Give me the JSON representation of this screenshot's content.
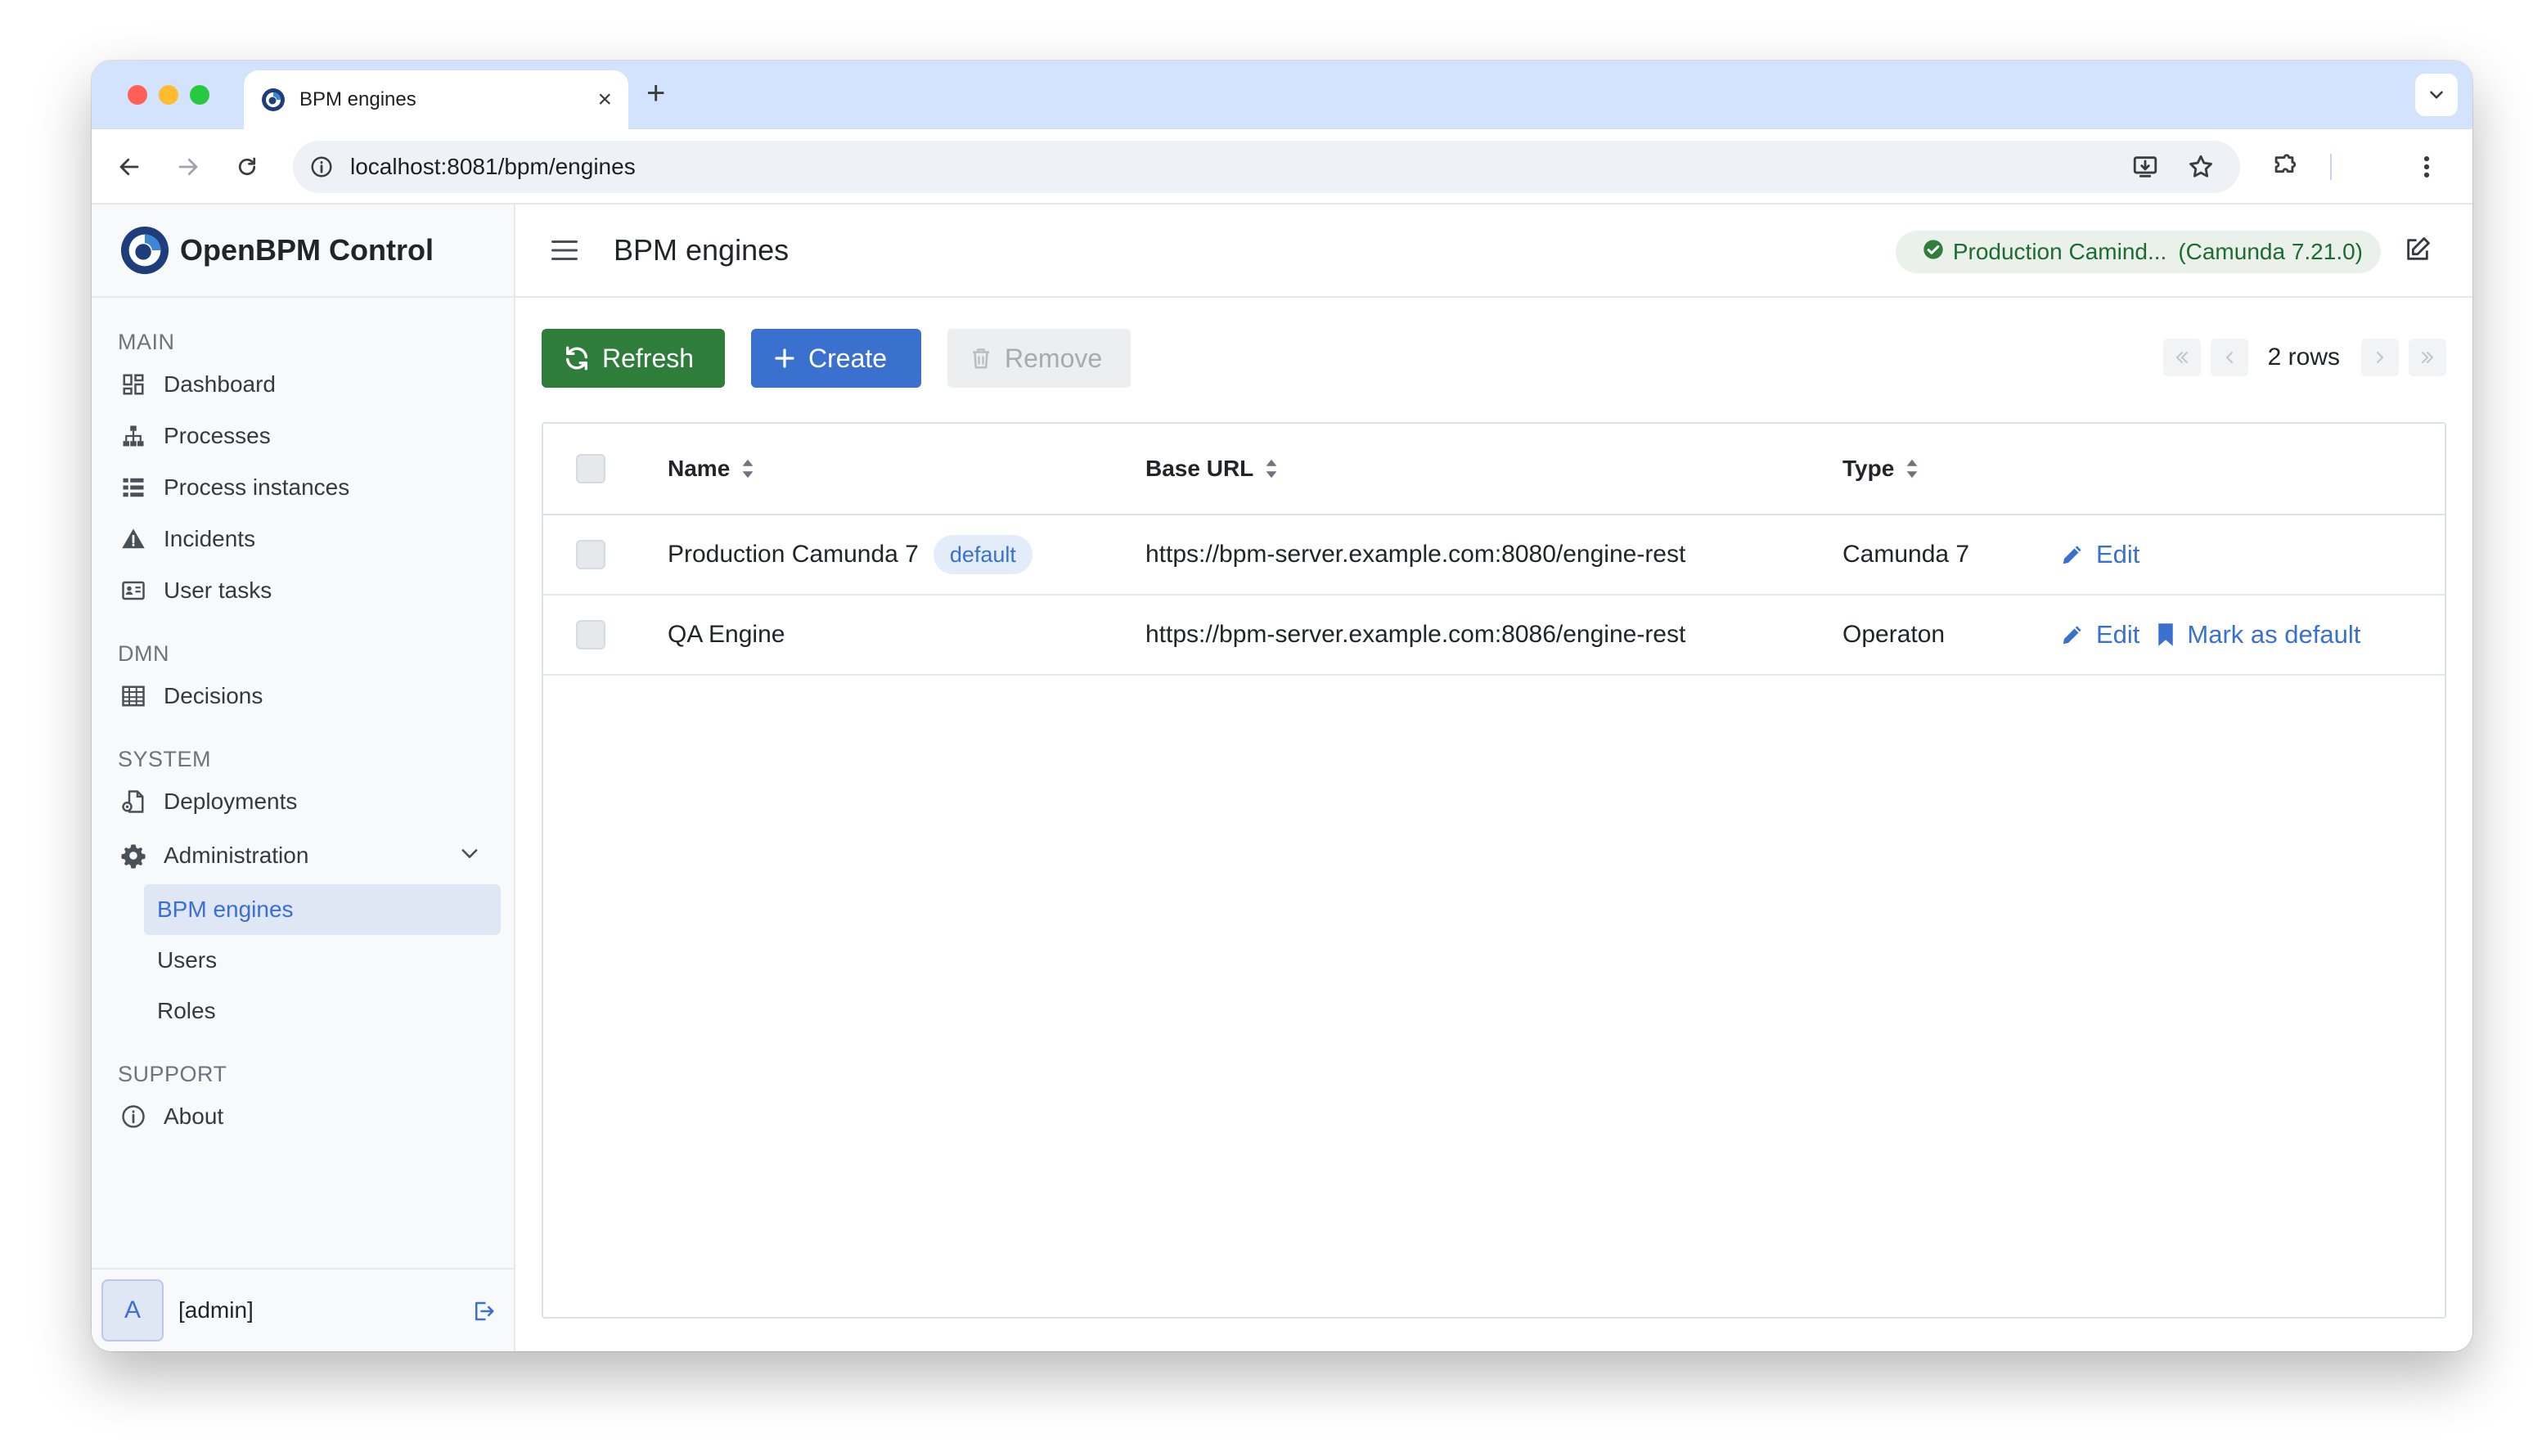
{
  "browser": {
    "tab_title": "BPM engines",
    "url": "localhost:8081/bpm/engines"
  },
  "brand": {
    "name": "OpenBPM Control"
  },
  "sidebar": {
    "sections": {
      "main": "MAIN",
      "dmn": "DMN",
      "system": "SYSTEM",
      "support": "SUPPORT"
    },
    "items": {
      "dashboard": "Dashboard",
      "processes": "Processes",
      "process_instances": "Process instances",
      "incidents": "Incidents",
      "user_tasks": "User tasks",
      "decisions": "Decisions",
      "deployments": "Deployments",
      "administration": "Administration",
      "about": "About"
    },
    "admin_sub": {
      "bpm_engines": "BPM engines",
      "users": "Users",
      "roles": "Roles"
    },
    "user": {
      "avatar_letter": "A",
      "name": "[admin]"
    }
  },
  "header": {
    "title": "BPM engines",
    "engine_name": "Production Camind...",
    "engine_version": "(Camunda 7.21.0)"
  },
  "actions": {
    "refresh": "Refresh",
    "create": "Create",
    "remove": "Remove",
    "rows_count": "2 rows"
  },
  "table": {
    "columns": {
      "name": "Name",
      "base_url": "Base URL",
      "type": "Type"
    },
    "rows": [
      {
        "name": "Production Camunda 7",
        "badge": "default",
        "base_url": "https://bpm-server.example.com:8080/engine-rest",
        "type": "Camunda 7",
        "edit": "Edit"
      },
      {
        "name": "QA Engine",
        "base_url": "https://bpm-server.example.com:8086/engine-rest",
        "type": "Operaton",
        "edit": "Edit",
        "mark_default": "Mark as default"
      }
    ]
  },
  "colors": {
    "refresh_bg": "#2e7d3a",
    "create_bg": "#3b71ce",
    "link": "#3b71ce",
    "active_nav_bg": "#dfe7f5",
    "engine_pill_bg": "#eaf1ea",
    "chrome_tabstrip": "#d3e3fd"
  },
  "icons": {
    "tab": "openbpm-logo-icon",
    "nav": [
      "dashboard-icon",
      "sitemap-icon",
      "list-icon",
      "warning-icon",
      "id-card-icon",
      "table-icon",
      "file-deploy-icon",
      "gear-icon",
      "info-icon"
    ],
    "buttons": [
      "refresh-icon",
      "plus-icon",
      "trash-icon"
    ]
  }
}
